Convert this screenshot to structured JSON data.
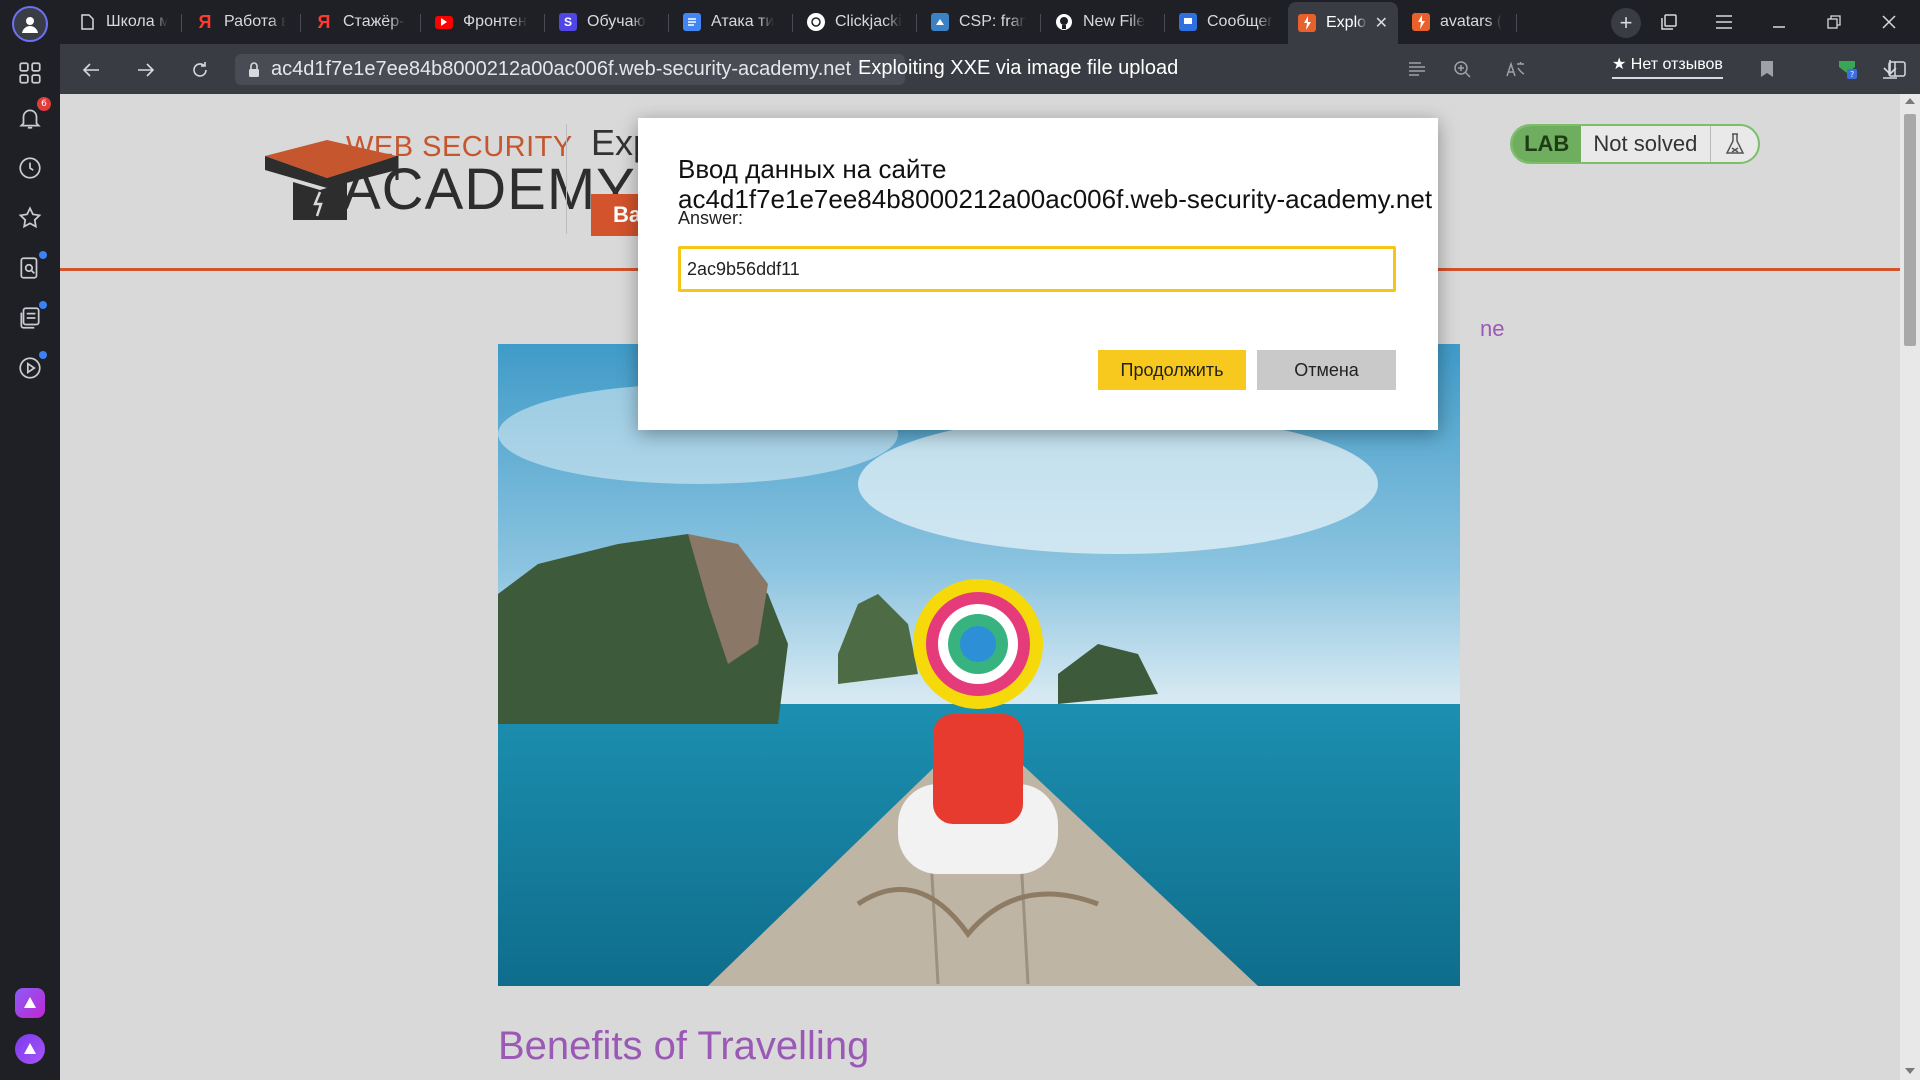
{
  "browser": {
    "tabs": [
      {
        "title": "Школа м",
        "icon": "file-icon"
      },
      {
        "title": "Работа в",
        "icon": "yandex-icon"
      },
      {
        "title": "Стажёр-р",
        "icon": "yandex-icon"
      },
      {
        "title": "Фронтен",
        "icon": "youtube-icon"
      },
      {
        "title": "Обучаю",
        "icon": "s-icon"
      },
      {
        "title": "Атака ти",
        "icon": "docs-icon"
      },
      {
        "title": "Clickjacki",
        "icon": "clickjacking-icon"
      },
      {
        "title": "CSP: fran",
        "icon": "csp-icon"
      },
      {
        "title": "New File",
        "icon": "github-icon"
      },
      {
        "title": "Сообщег",
        "icon": "chat-icon"
      },
      {
        "title": "Exploi",
        "icon": "portswigger-icon",
        "active": true
      },
      {
        "title": "avatars (",
        "icon": "portswigger-icon"
      }
    ],
    "url": "ac4d1f7e1e7ee84b8000212a00ac006f.web-security-academy.net",
    "page_title": "Exploiting XXE via image file upload",
    "reviews_label": "★ Нет отзывов",
    "notification_count": "6"
  },
  "page": {
    "logo_top": "WEB SECURITY",
    "logo_bottom": "ACADEMY",
    "heading_fragment": "Exp",
    "back_fragment": "Ba",
    "lab_tag": "LAB",
    "lab_status": "Not solved",
    "home_fragment": "ne",
    "post_title": "Benefits of Travelling"
  },
  "dialog": {
    "title": "Ввод данных на сайте",
    "host": "ac4d1f7e1e7ee84b8000212a00ac006f.web-security-academy.net",
    "label": "Answer:",
    "value": "2ac9b56ddf11",
    "ok_label": "Продолжить",
    "cancel_label": "Отмена"
  },
  "colors": {
    "accent_orange": "#d2532c",
    "link_purple": "#9b59b6",
    "dialog_yellow": "#f7c81e",
    "lab_green": "#6fae5e"
  }
}
